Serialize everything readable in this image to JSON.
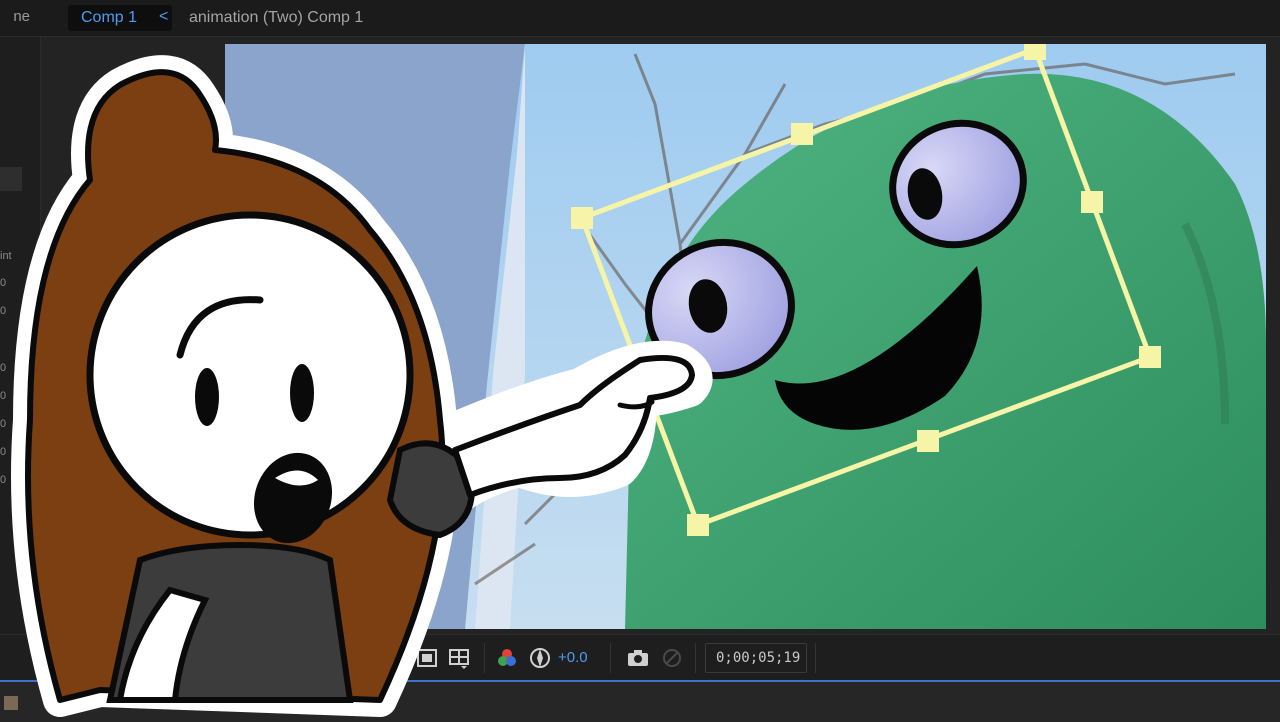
{
  "topbar": {
    "panel_fragment": "ne",
    "active_tab": "Comp 1",
    "tab_close": "<",
    "breadcrumb": "animation (Two) Comp 1"
  },
  "left_panel": {
    "label": "int",
    "values": [
      "0",
      "0",
      "0",
      "0",
      "0",
      "0",
      "0"
    ]
  },
  "viewer_toolbar": {
    "exposure": "+0.0",
    "timecode": "0;00;05;19",
    "icons": [
      "mask-visibility-icon",
      "region-of-interest-icon",
      "transparency-grid-icon",
      "channel-icon",
      "exposure-reset-icon",
      "snapshot-camera-icon",
      "show-snapshot-icon"
    ]
  },
  "colors": {
    "accent": "#4d9cf0",
    "selection": "#f6f4a6",
    "creature_green": "#3fa271",
    "hair": "#7b3f12"
  }
}
